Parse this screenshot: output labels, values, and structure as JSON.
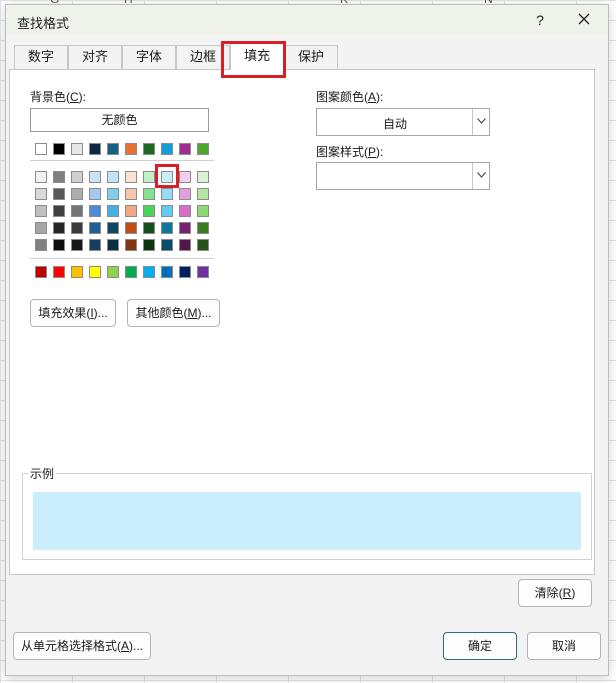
{
  "background_sheet": {
    "column_letters": [
      "G",
      "H",
      "K",
      "N"
    ]
  },
  "dialog": {
    "title": "查找格式",
    "help_label": "?",
    "close_icon": "close-icon"
  },
  "tabs": [
    {
      "label": "数字",
      "active": false
    },
    {
      "label": "对齐",
      "active": false
    },
    {
      "label": "字体",
      "active": false
    },
    {
      "label": "边框",
      "active": false
    },
    {
      "label": "填充",
      "active": true
    },
    {
      "label": "保护",
      "active": false
    }
  ],
  "fill": {
    "background_color_label": "背景色(",
    "background_color_key": "C",
    "background_color_suffix": "):",
    "no_color_label": "无颜色",
    "palette_top_row": [
      "#ffffff",
      "#000000",
      "#e7e6e6",
      "#44546a",
      "#4472c4",
      "#ed7d31",
      "#a5a5a5",
      "#ffc000",
      "#5b9bd5",
      "#70ad47"
    ],
    "palette_top_row_actual": [
      "#ffffff",
      "#000000",
      "#e8e8e8",
      "#0e2841",
      "#156082",
      "#e97132",
      "#196b24",
      "#0f9ed5",
      "#a02b93",
      "#4ea72e"
    ],
    "palette_theme_rows": [
      [
        "#f2f2f2",
        "#7f7f7f",
        "#d0d0d0",
        "#c9e3f6",
        "#c1e4f5",
        "#fbe2d5",
        "#c1f0c8",
        "#caeefb",
        "#f2cfee",
        "#daf2d0"
      ],
      [
        "#d9d9d9",
        "#595959",
        "#adadad",
        "#a5c8ee",
        "#83cbeb",
        "#f7c7ac",
        "#83e28e",
        "#94dcf8",
        "#e59edd",
        "#b5e6a2"
      ],
      [
        "#bfbfbf",
        "#404040",
        "#757575",
        "#4c8ed6",
        "#45b0e1",
        "#f1a983",
        "#47d459",
        "#61cbf3",
        "#d86dcd",
        "#8ed973"
      ],
      [
        "#a6a6a6",
        "#262626",
        "#3a3a3a",
        "#215f9a",
        "#0f4761",
        "#c04f15",
        "#124f1a",
        "#0b769f",
        "#77206d",
        "#3b7d23"
      ],
      [
        "#808080",
        "#0d0d0d",
        "#171717",
        "#163e64",
        "#0a2f41",
        "#803510",
        "#0c3511",
        "#074f69",
        "#501549",
        "#275318"
      ]
    ],
    "palette_standard_row": [
      "#c00000",
      "#ff0000",
      "#ffc000",
      "#ffff00",
      "#92d050",
      "#00b050",
      "#00b0f0",
      "#0070c0",
      "#002060",
      "#7030a0"
    ],
    "selected_color": "#caeefb",
    "fill_effects_label": "填充效果(",
    "fill_effects_key": "I",
    "fill_effects_suffix": ")...",
    "more_colors_label": "其他颜色(",
    "more_colors_key": "M",
    "more_colors_suffix": ")...",
    "pattern_color_label": "图案颜色(",
    "pattern_color_key": "A",
    "pattern_color_suffix": "):",
    "pattern_color_value": "自动",
    "pattern_style_label": "图案样式(",
    "pattern_style_key": "P",
    "pattern_style_suffix": "):",
    "pattern_style_value": ""
  },
  "sample": {
    "label": "示例",
    "preview_color": "#caeefb"
  },
  "buttons": {
    "clear_label": "清除(",
    "clear_key": "R",
    "clear_suffix": ")",
    "choose_from_cell_label": "从单元格选择格式(",
    "choose_from_cell_key": "A",
    "choose_from_cell_suffix": ")...",
    "ok_label": "确定",
    "cancel_label": "取消"
  },
  "colors": {
    "highlight": "#d81f26",
    "title_bar": "#eef2ea",
    "dialog_bg": "#f3f3f3"
  }
}
